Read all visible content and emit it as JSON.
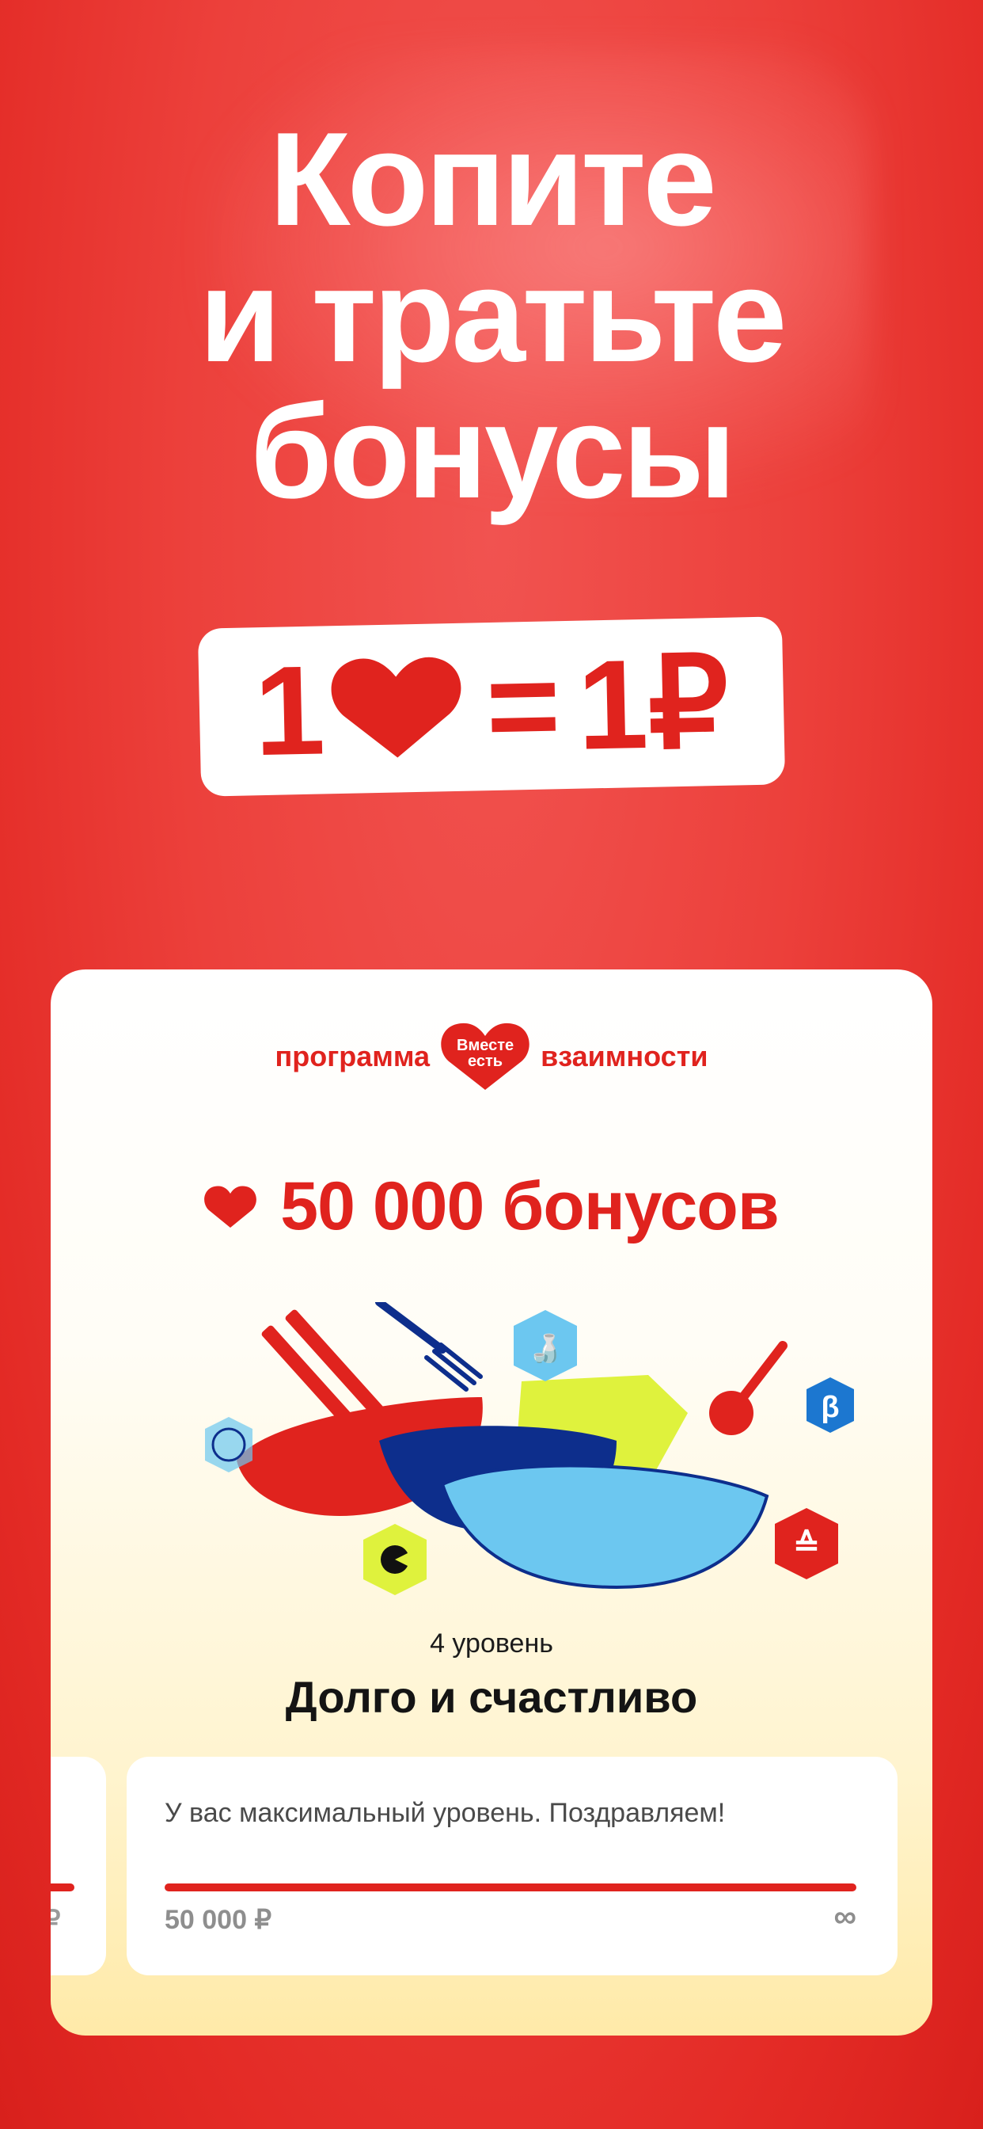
{
  "headline": {
    "line1": "Копите",
    "line2": "и тратьте",
    "line3": "бонусы"
  },
  "equation": {
    "left": "1",
    "equals": "=",
    "right": "1₽"
  },
  "program": {
    "prefix": "программа",
    "logo_top": "Вместе",
    "logo_bottom": "есть",
    "suffix": "взаимности"
  },
  "bonus": {
    "amount": "50 000 бонусов"
  },
  "level": {
    "number": "4 уровень",
    "name": "Долго и счастливо"
  },
  "progress": {
    "message": "У вас максимальный уровень. Поздравляем!",
    "prev_value": "₽",
    "from": "50 000 ₽",
    "to": "∞"
  },
  "colors": {
    "brand_red": "#e0231e",
    "background": "#ec403b",
    "accent_lime": "#dff23d",
    "accent_blue": "#6cc7f0",
    "navy": "#0d2e8c"
  }
}
